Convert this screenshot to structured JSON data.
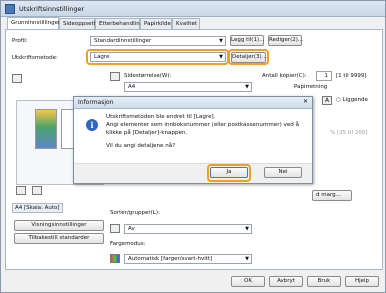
{
  "window": {
    "title": "Utskriftsinnstillinger"
  },
  "tabs": [
    {
      "label": "Grunninnstillinger"
    },
    {
      "label": "Sideoppsett"
    },
    {
      "label": "Etterbehandling"
    },
    {
      "label": "Papirkilde"
    },
    {
      "label": "Kvalitet"
    }
  ],
  "profile": {
    "label": "Profil:",
    "value": "Standardinnstillinger",
    "add_button": "Legg til(1)...",
    "edit_button": "Rediger(2)..."
  },
  "output_method": {
    "label": "Utskriftsmetode:",
    "value": "Lagre",
    "details_button": "Detaljer(3)..."
  },
  "page_size": {
    "label": "Sidestørrelse(W):",
    "value": "A4"
  },
  "copies": {
    "label": "Antall kopier(C):",
    "value": "1",
    "range": "[1 til 9999]"
  },
  "orientation": {
    "label": "Papirretning",
    "landscape_label": "Liggende"
  },
  "status": {
    "preview_label": "A4 [Skala: Auto]"
  },
  "side_buttons": {
    "view_settings": "Visningsinnstillinger",
    "restore_defaults": "Tilbakestill standarder"
  },
  "sort": {
    "label": "Sorter/grupper(L):",
    "value": "Av"
  },
  "color": {
    "label": "Fargemodus:",
    "value": "Automatisk [farger/svart-hvitt]"
  },
  "scale_partial": {
    "text": "% [25 til 200]",
    "button_fragment": "d marg..."
  },
  "dialog": {
    "title": "Informasjon",
    "line1": "Utskriftsmetoden ble endret til [Lagre].",
    "line2": "Angi elementer som innboksnummer (eller postkassenummer) ved å",
    "line3": "klikke på [Detaljer]-knappen.",
    "question": "Vil du angi detaljene nå?",
    "yes": "Ja",
    "no": "Nei"
  },
  "footer": {
    "ok": "OK",
    "cancel": "Avbryt",
    "apply": "Bruk",
    "help": "Hjelp"
  },
  "accent_color": "#f0a020"
}
